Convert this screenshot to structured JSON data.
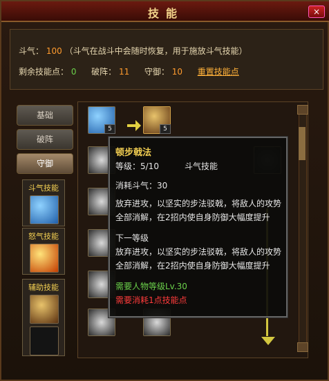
{
  "window": {
    "title": "技能",
    "close_label": "×"
  },
  "header": {
    "energy_label": "斗气：",
    "energy_value": "100",
    "energy_desc": "（斗气在战斗中会随时恢复，用于施放斗气技能）",
    "remaining_label": "剩余技能点：",
    "remaining_value": "0",
    "break_label": "破阵：",
    "break_value": "11",
    "defense_label": "守御：",
    "defense_value": "10",
    "reset_label": "重置技能点"
  },
  "tabs": [
    {
      "label": "基础"
    },
    {
      "label": "破阵"
    },
    {
      "label": "守御"
    }
  ],
  "left_sections": [
    {
      "title": "斗气技能"
    },
    {
      "title": "怒气技能"
    },
    {
      "title": "辅助技能"
    }
  ],
  "skill_badges": [
    "5",
    "5"
  ],
  "tooltip": {
    "name": "顿步戟法",
    "level": "等级：5/10",
    "type": "斗气技能",
    "cost": "消耗斗气：30",
    "desc_line1": "放弃进攻，以坚实的步法驳戟，将敌人的攻势",
    "desc_line2": "全部消解，在2招内使自身防御大幅度提升",
    "next_label": "下一等级",
    "next_line1": "放弃进攻，以坚实的步法驳戟，将敌人的攻势",
    "next_line2": "全部消解，在2招内使自身防御大幅度提升",
    "req_level": "需要人物等级Lv.30",
    "req_points": "需要消耗1点技能点"
  },
  "colors": {
    "accent_orange": "#ff9b2e",
    "accent_green": "#6bd14b",
    "accent_yellow": "#f3cf52",
    "accent_red": "#ff3b3b"
  }
}
